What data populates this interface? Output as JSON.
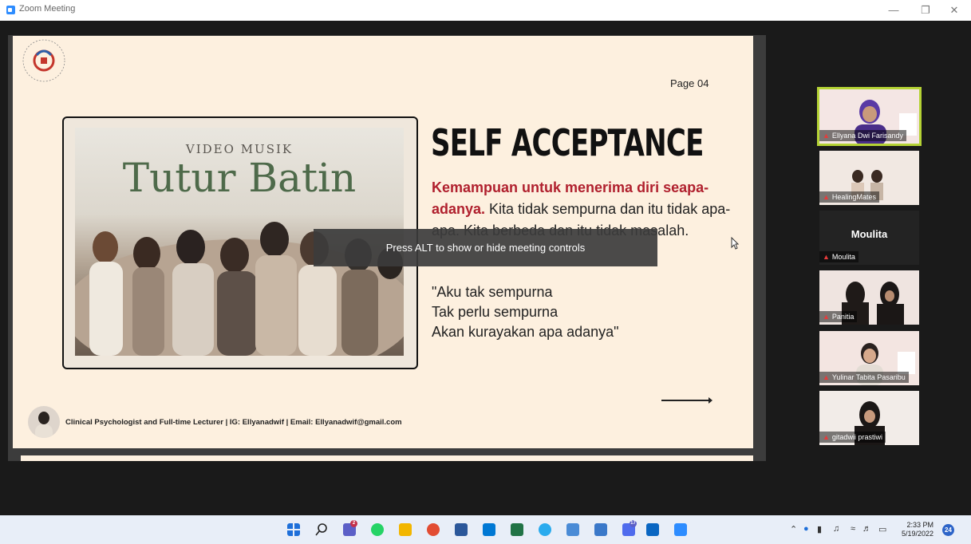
{
  "window": {
    "title": "Zoom Meeting"
  },
  "slide": {
    "page": "Page 04",
    "video_label": "VIDEO MUSIK",
    "video_title": "Tutur Batin",
    "heading": "SELF ACCEPTANCE",
    "para_highlight": "Kemampuan untuk menerima diri seapa-adanya.",
    "para_rest": " Kita tidak sempurna dan itu tidak apa-apa. Kita berbeda dan itu tidak masalah.",
    "quote": [
      "\"Aku tak sempurna",
      "Tak perlu sempurna",
      "Akan kurayakan apa adanya\""
    ],
    "footer": "Clinical Psychologist and Full-time Lecturer | IG: Ellyanadwif | Email: Ellyanadwif@gmail.com"
  },
  "toast": "Press ALT to show or hide meeting controls",
  "participants": [
    {
      "name": "Ellyana Dwi Farisandy",
      "active": true
    },
    {
      "name": "HealingMates"
    },
    {
      "name": "Moulita",
      "video_off": true
    },
    {
      "name": "Panitia"
    },
    {
      "name": "Yulinar Tabita Pasaribu"
    },
    {
      "name": "gitadwii prastiwi"
    }
  ],
  "taskbar": {
    "time": "2:33 PM",
    "date": "5/19/2022",
    "notifications": "24",
    "teams_badge": "2",
    "app_badge": "17"
  },
  "colors": {
    "accent": "#b0202e",
    "active_speaker": "#b5d335",
    "zoom_blue": "#2d8cff"
  }
}
